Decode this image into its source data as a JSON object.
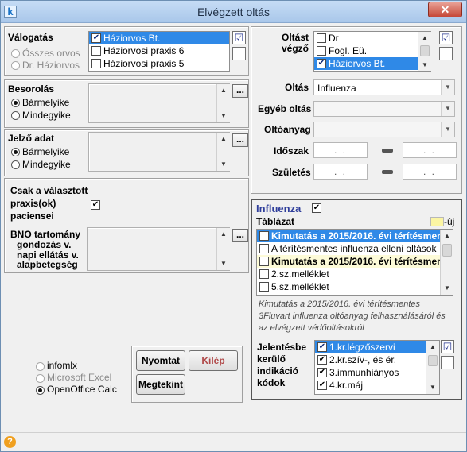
{
  "window": {
    "title": "Elvégzett oltás",
    "app_icon": "k",
    "close_symbol": "✕"
  },
  "valogatas": {
    "label": "Válogatás",
    "radio_all": "Összes orvos",
    "radio_dr": "Dr. Háziorvos",
    "list": [
      {
        "text": "Háziorvos Bt.",
        "checked": true,
        "selected": true
      },
      {
        "text": "Háziorvosi praxis 6",
        "checked": false
      },
      {
        "text": "Háziorvosi praxis 5",
        "checked": false
      }
    ]
  },
  "besorolas": {
    "label": "Besorolás",
    "opt1": "Bármelyike",
    "opt2": "Mindegyike"
  },
  "jelzo": {
    "label": "Jelző adat",
    "opt1": "Bármelyike",
    "opt2": "Mindegyike"
  },
  "csak": {
    "label_line1": "Csak a választott",
    "label_line2": "praxis(ok)",
    "label_line3": "paciensei",
    "check": "✔"
  },
  "bno": {
    "label": "BNO tartomány",
    "line2": "gondozás v.",
    "line3": "napi ellátás v.",
    "line4": "alapbetegség"
  },
  "oltast_vegzo": {
    "label_line1": "Oltást",
    "label_line2": "végző",
    "list": [
      {
        "text": "Dr",
        "checked": false
      },
      {
        "text": "Fogl. Eü.",
        "checked": false
      },
      {
        "text": "Háziorvos Bt.",
        "checked": true,
        "selected": true
      }
    ]
  },
  "fields": {
    "oltas_label": "Oltás",
    "oltas_value": "Influenza",
    "egyeb_label": "Egyéb oltás",
    "oltoanyag_label": "Oltóanyag",
    "idoszak_label": "Időszak",
    "szuletes_label": "Születés",
    "date_placeholder": ". ."
  },
  "influenza": {
    "label": "Influenza",
    "check": "✔",
    "tablazat_label": "Táblázat",
    "uj_label": "-új",
    "rows": [
      {
        "text": "Kimutatás a 2015/2016. évi térítésmen",
        "checked": false,
        "style": "sel"
      },
      {
        "text": "A térítésmentes influenza elleni oltások",
        "checked": false,
        "style": "normal"
      },
      {
        "text": "Kimutatás a 2015/2016. évi térítésmen",
        "checked": false,
        "style": "bold"
      },
      {
        "text": "2.sz.melléklet",
        "checked": false,
        "style": "normal"
      },
      {
        "text": "5.sz.melléklet",
        "checked": false,
        "style": "normal"
      }
    ],
    "description": "Kimutatás a 2015/2016. évi térítésmentes 3Fluvart influenza oltóanyag felhasználásáról és az elvégzett védőoltásokról",
    "jelentes_line1": "Jelentésbe",
    "jelentes_line2": "kerülő",
    "jelentes_line3": "indikáció",
    "jelentes_line4": "kódok",
    "codes": [
      {
        "text": "1.kr.légzőszervi",
        "checked": true,
        "selected": true
      },
      {
        "text": "2.kr.szív-, és ér.",
        "checked": true
      },
      {
        "text": "3.immunhiányos",
        "checked": true
      },
      {
        "text": "4.kr.máj",
        "checked": true
      }
    ]
  },
  "export": {
    "opt1": "infomlx",
    "opt2": "Microsoft Excel",
    "opt3": "OpenOffice Calc"
  },
  "buttons": {
    "nyomtat": "Nyomtat",
    "kilep": "Kilép",
    "megtekint": "Megtekint",
    "dots": "..."
  },
  "status": {
    "help": "?"
  }
}
